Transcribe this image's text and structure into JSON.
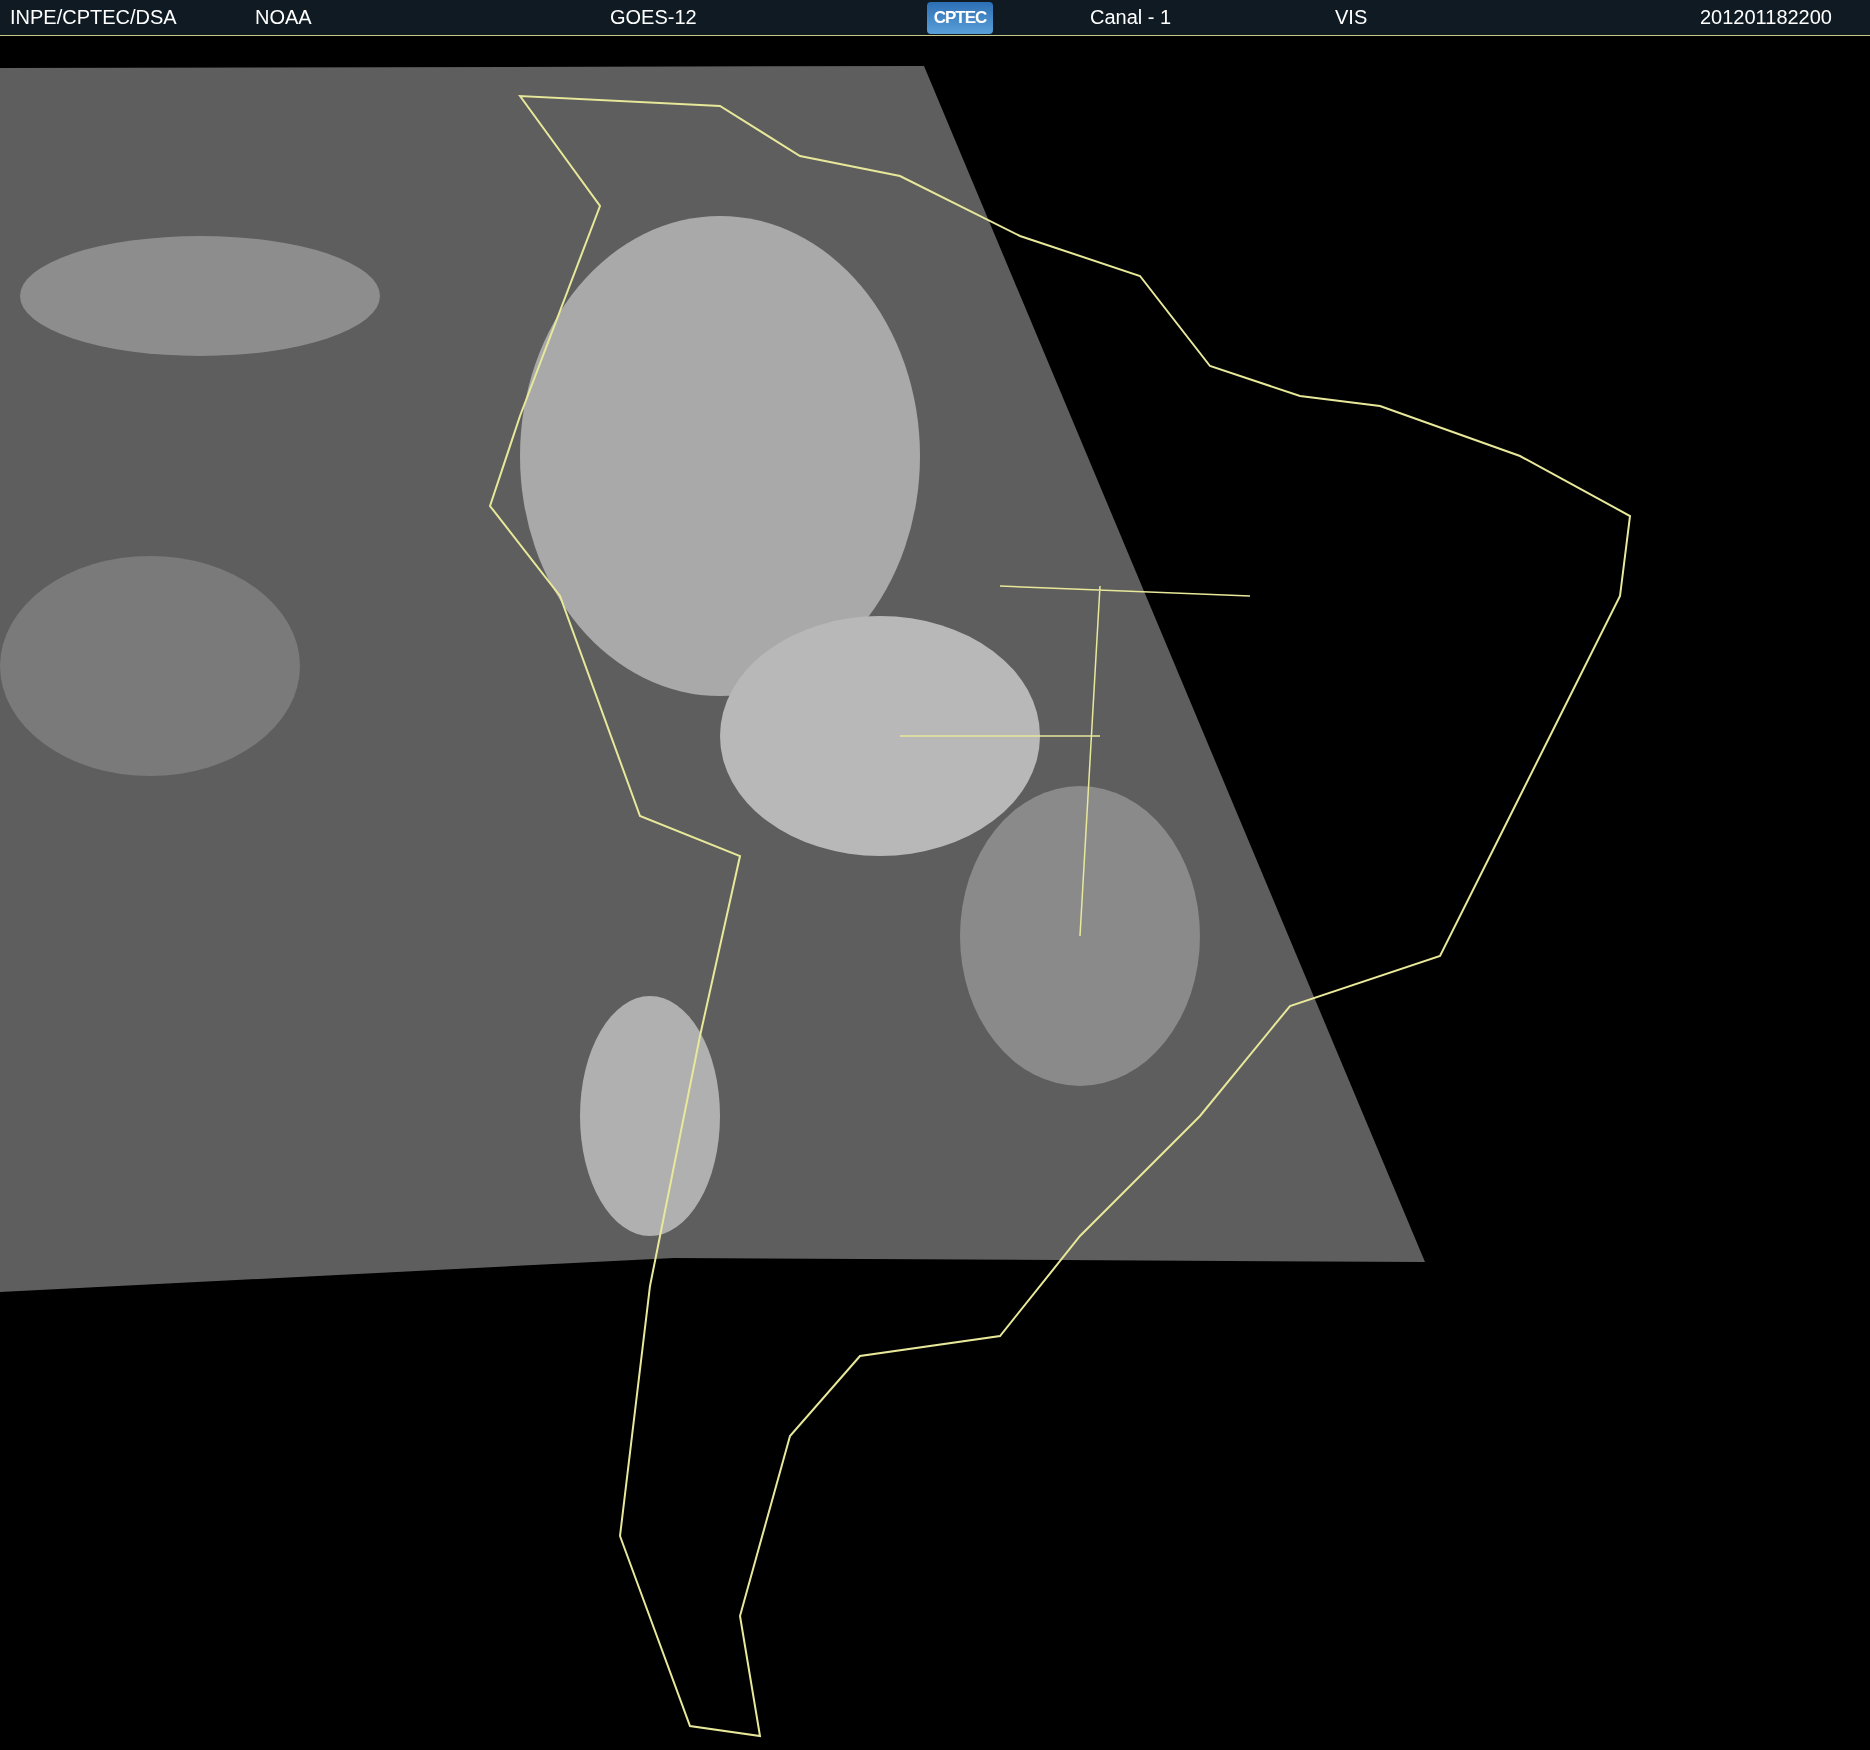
{
  "header": {
    "items": [
      {
        "kind": "text",
        "text": "INPE/CPTEC/DSA"
      },
      {
        "kind": "text",
        "text": "NOAA"
      },
      {
        "kind": "text",
        "text": "GOES-12"
      },
      {
        "kind": "logo",
        "text": "CPTEC"
      },
      {
        "kind": "text",
        "text": "Canal - 1"
      },
      {
        "kind": "text",
        "text": "VIS"
      },
      {
        "kind": "text",
        "text": "201201182200"
      }
    ]
  }
}
